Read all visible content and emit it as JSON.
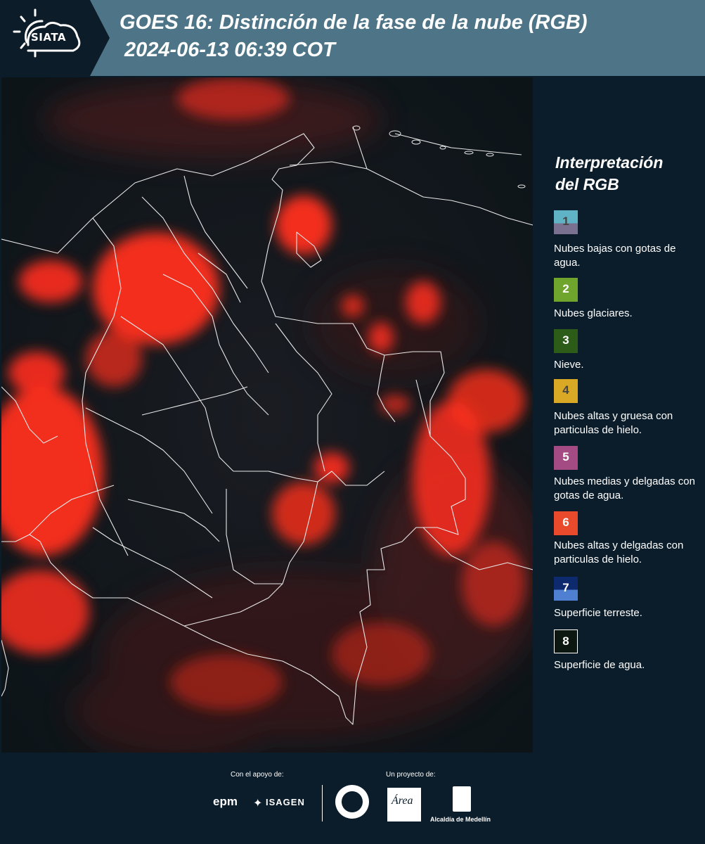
{
  "header": {
    "logo_text": "SIATA",
    "title_line1": "GOES 16: Distinción de la fase de la nube (RGB)",
    "title_line2": "2024-06-13 06:39 COT"
  },
  "legend": {
    "title_line1": "Interpretación",
    "title_line2": "del RGB",
    "items": [
      {
        "number": "1",
        "label": "Nubes bajas con gotas de agua.",
        "color_top": "#5fb3c4",
        "color_bottom": "#7a7190",
        "text_color": "#444444"
      },
      {
        "number": "2",
        "label": "Nubes glaciares.",
        "color_top": "#6fa52c",
        "color_bottom": "#6fa52c",
        "text_color": "#ffffff"
      },
      {
        "number": "3",
        "label": "Nieve.",
        "color_top": "#2d5b18",
        "color_bottom": "#2d5b18",
        "text_color": "#ffffff"
      },
      {
        "number": "4",
        "label": "Nubes altas y gruesa con particulas de hielo.",
        "color_top": "#d9a824",
        "color_bottom": "#d9a824",
        "text_color": "#444444"
      },
      {
        "number": "5",
        "label": "Nubes medias y delgadas con gotas de agua.",
        "color_top": "#a34b82",
        "color_bottom": "#a34b82",
        "text_color": "#ffffff"
      },
      {
        "number": "6",
        "label": "Nubes altas y delgadas con particulas de hielo.",
        "color_top": "#e84a2b",
        "color_bottom": "#e84a2b",
        "text_color": "#ffffff"
      },
      {
        "number": "7",
        "label": "Superficie terreste.",
        "color_top": "#0e2a6e",
        "color_bottom": "#4f7fd0",
        "text_color": "#ffffff"
      },
      {
        "number": "8",
        "label": "Superficie de agua.",
        "color_top": "#0b1710",
        "color_bottom": "#0b1710",
        "text_color": "#ffffff"
      }
    ]
  },
  "footer": {
    "support_label": "Con el apoyo de:",
    "project_label": "Un proyecto de:",
    "sponsor1": "epm",
    "sponsor2": "ISAGEN",
    "area_logo_text": "Área",
    "alcaldia_text": "Alcaldía de Medellín"
  },
  "colors": {
    "header_bg": "#4d7587",
    "logo_bg": "#0c1c28",
    "page_bg": "#0b1d2a",
    "cloud_red": "#ff3b24"
  }
}
